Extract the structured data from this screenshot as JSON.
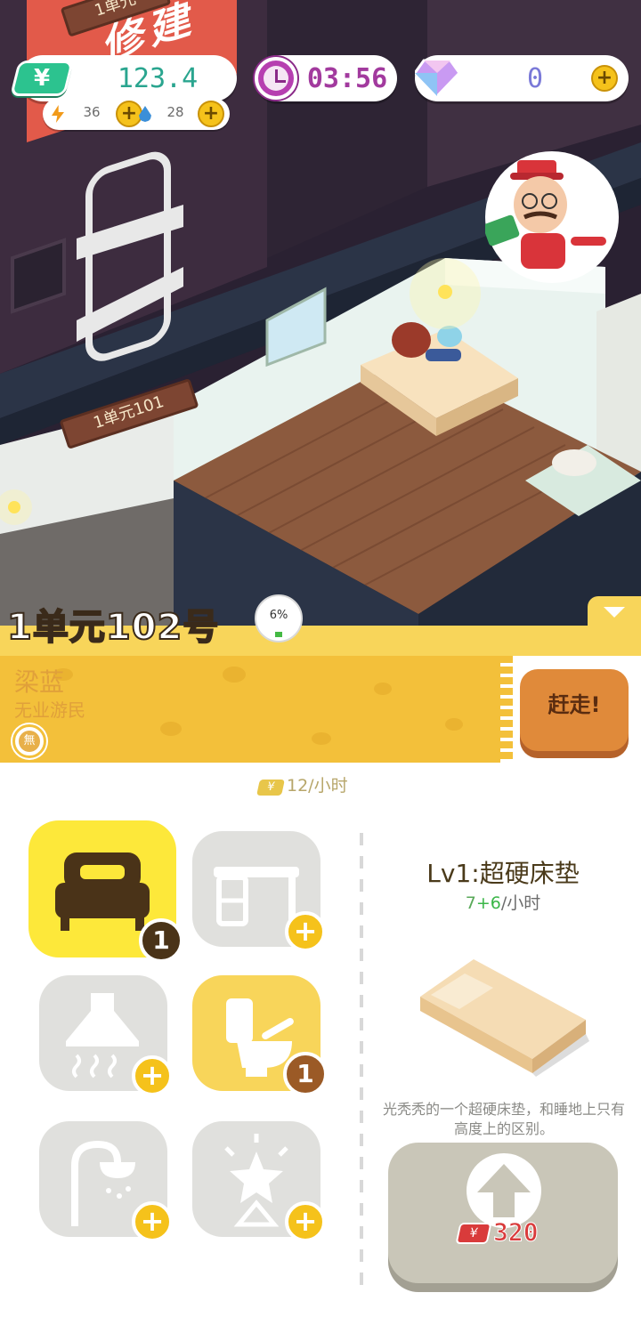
{
  "hud": {
    "money": "123.4",
    "money_icon_glyph": "¥",
    "timer": "03:56",
    "gems": "0",
    "energy": "36",
    "water": "28",
    "plus": "+"
  },
  "scene": {
    "top_banner_text": "修建",
    "top_sign_text": "1单元",
    "sign_101": "1单元101"
  },
  "room": {
    "title": "1单元102号",
    "occupancy": "6%",
    "occupancy_level": 0.06
  },
  "tenant": {
    "name": "梁蓝",
    "occupation": "无业游民",
    "tag": "無",
    "evict_label": "赶走!"
  },
  "rent": {
    "yen": "¥",
    "rate": "12/小时"
  },
  "furniture": {
    "slots": [
      {
        "name": "bed",
        "icon": "bed-icon",
        "state": "selected",
        "level": "1"
      },
      {
        "name": "desk",
        "icon": "desk-icon",
        "state": "locked",
        "level": ""
      },
      {
        "name": "range-hood",
        "icon": "range-hood-icon",
        "state": "locked",
        "level": ""
      },
      {
        "name": "toilet",
        "icon": "toilet-icon",
        "state": "owned",
        "level": "1"
      },
      {
        "name": "shower",
        "icon": "shower-icon",
        "state": "locked",
        "level": ""
      },
      {
        "name": "decor",
        "icon": "star-lamp-icon",
        "state": "locked",
        "level": ""
      }
    ]
  },
  "detail": {
    "title": "Lv1:超硬床垫",
    "rate_base": "7",
    "rate_bonus": "+6",
    "rate_unit": "/小时",
    "description": "光秃秃的一个超硬床垫，和睡地上只有高度上的区别。",
    "upgrade_cost": "320",
    "upgrade_yen": "¥"
  },
  "colors": {
    "accent_yellow": "#f8d55a",
    "selected_yellow": "#fde83a",
    "money_green": "#2cc38f",
    "timer_purple": "#a23a9e",
    "cost_red": "#d93b3b"
  }
}
